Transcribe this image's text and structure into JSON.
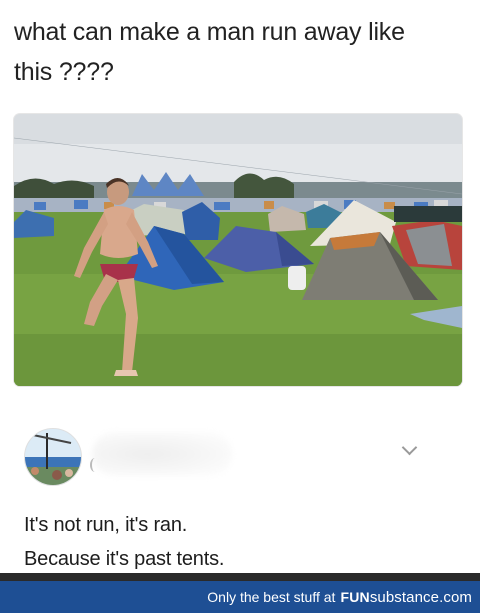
{
  "post": {
    "line1": "what can make a man  run away like",
    "line2": "this ????"
  },
  "comment": {
    "line1": "It's not run, it's ran.",
    "line2": "Because it's past tents."
  },
  "footer": {
    "tagline": "Only the best stuff at",
    "brand_bold": "FUN",
    "brand_rest": "substance.com"
  },
  "icons": {
    "menu": "chevron-down-icon"
  },
  "colors": {
    "footer_bg": "#1e4f94",
    "text": "#222222"
  }
}
